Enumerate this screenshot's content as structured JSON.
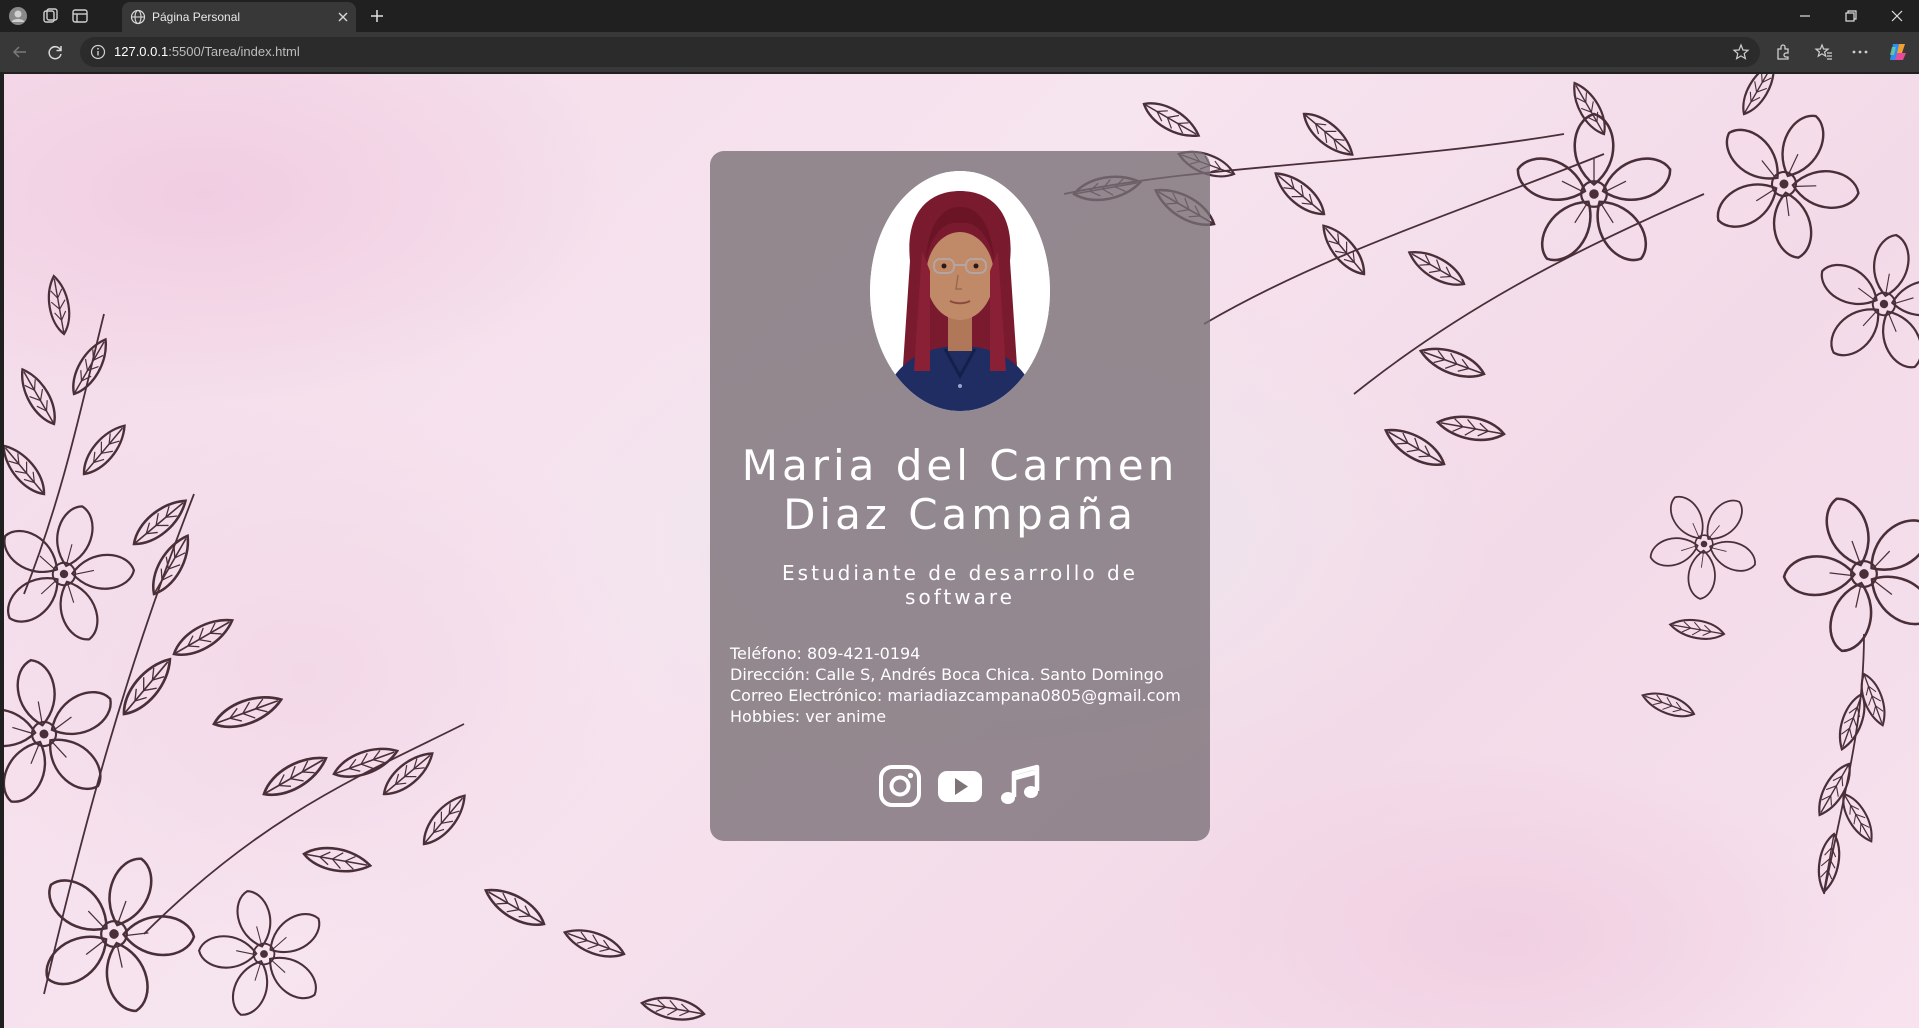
{
  "browser": {
    "tab_title": "Página Personal",
    "url_host": "127.0.0.1",
    "url_rest": ":5500/Tarea/index.html"
  },
  "profile": {
    "name_line1": "Maria del Carmen",
    "name_line2": "Diaz Campaña",
    "subtitle": "Estudiante de desarrollo de software",
    "phone": "Teléfono: 809-421-0194",
    "address": "Dirección: Calle S, Andrés Boca Chica. Santo Domingo",
    "email": "Correo Electrónico: mariadiazcampana0805@gmail.com",
    "hobbies": "Hobbies: ver anime"
  },
  "socials": [
    {
      "icon": "instagram-icon"
    },
    {
      "icon": "youtube-icon"
    },
    {
      "icon": "music-icon"
    }
  ],
  "colors": {
    "card": "#786e74",
    "background": "#f4dbe9",
    "line_art": "#4a2f38"
  }
}
